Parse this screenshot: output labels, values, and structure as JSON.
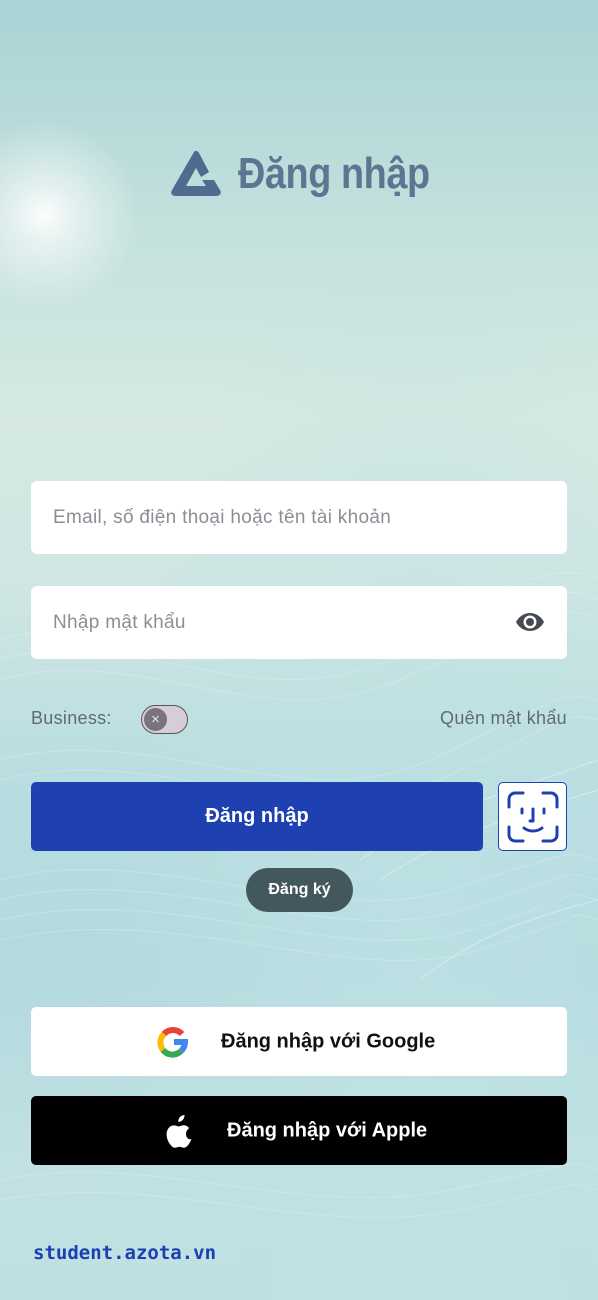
{
  "header": {
    "title": "Đăng nhập",
    "logo_icon": "azota-triangle-logo"
  },
  "form": {
    "username": {
      "placeholder": "Email, số điện thoại hoặc tên tài khoản",
      "value": ""
    },
    "password": {
      "placeholder": "Nhập mật khẩu",
      "value": "",
      "toggle_icon": "eye-icon"
    },
    "business": {
      "label": "Business:",
      "enabled": false,
      "knob_glyph": "×"
    },
    "forgot_password_label": "Quên mật khẩu",
    "login_label": "Đăng nhập",
    "faceid_icon": "face-id-icon",
    "register_label": "Đăng ký"
  },
  "social": {
    "google_label": "Đăng nhập với Google",
    "apple_label": "Đăng nhập với Apple"
  },
  "footer": {
    "site_url": "student.azota.vn"
  },
  "colors": {
    "primary": "#1e40b0",
    "brand_text": "#5d7590",
    "register_bg": "#42585c",
    "apple_bg": "#000000"
  }
}
